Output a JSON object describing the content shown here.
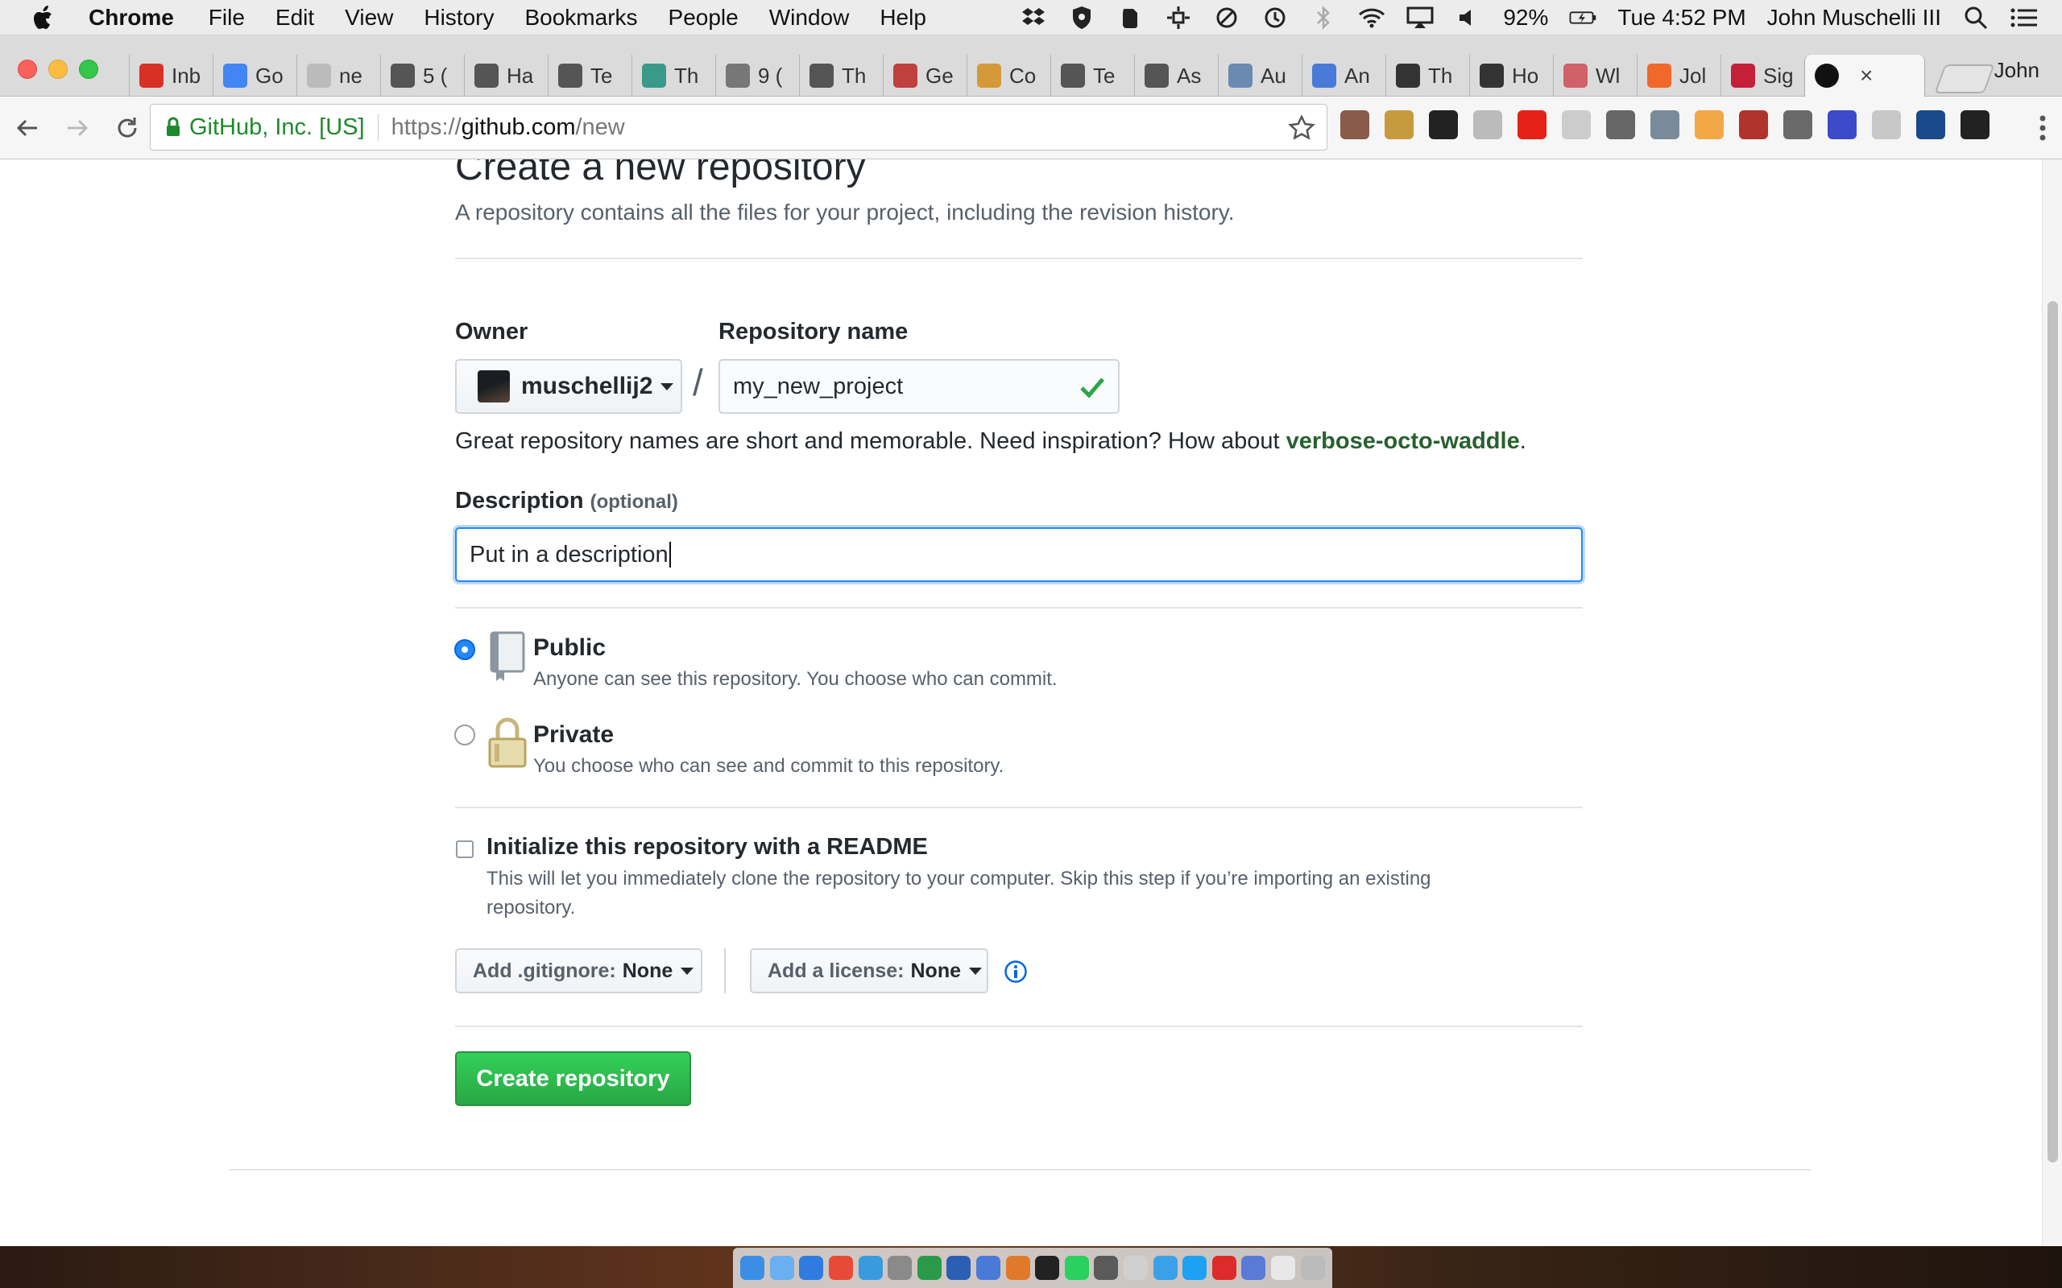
{
  "menubar": {
    "app": "Chrome",
    "menus": [
      "File",
      "Edit",
      "View",
      "History",
      "Bookmarks",
      "People",
      "Window",
      "Help"
    ],
    "battery": "92%",
    "clock": "Tue 4:52 PM",
    "user": "John Muschelli III",
    "status_icons": [
      "dropbox-icon",
      "shield-icon",
      "evernote-icon",
      "move-icon",
      "sync-icon",
      "time-machine-icon",
      "bluetooth-icon",
      "wifi-icon",
      "airplay-icon",
      "volume-icon",
      "battery-icon"
    ]
  },
  "tabs": [
    {
      "label": "Inb",
      "favicon": "gmail-icon",
      "color": "#d93025"
    },
    {
      "label": "Go",
      "favicon": "calendar-icon",
      "color": "#4285f4"
    },
    {
      "label": "ne",
      "favicon": "page-icon",
      "color": "#bbbbbb"
    },
    {
      "label": "5 (",
      "favicon": "nyt-icon",
      "color": "#555555"
    },
    {
      "label": "Ha",
      "favicon": "nyt-icon",
      "color": "#555555"
    },
    {
      "label": "Te",
      "favicon": "nyt-icon",
      "color": "#555555"
    },
    {
      "label": "Th",
      "favicon": "mic-icon",
      "color": "#3a9a8a"
    },
    {
      "label": "9 (",
      "favicon": "doc-icon",
      "color": "#777777"
    },
    {
      "label": "Th",
      "favicon": "d-icon",
      "color": "#555555"
    },
    {
      "label": "Ge",
      "favicon": "br-icon",
      "color": "#c04040"
    },
    {
      "label": "Co",
      "favicon": "e-icon",
      "color": "#d49a3a"
    },
    {
      "label": "Te",
      "favicon": "nyt-icon",
      "color": "#555555"
    },
    {
      "label": "As",
      "favicon": "nyt-icon",
      "color": "#555555"
    },
    {
      "label": "Au",
      "favicon": "audio-icon",
      "color": "#6a8ab0"
    },
    {
      "label": "An",
      "favicon": "docs-icon",
      "color": "#4a7ad8"
    },
    {
      "label": "Th",
      "favicon": "a-icon",
      "color": "#333333"
    },
    {
      "label": "Ho",
      "favicon": "i-icon",
      "color": "#333333"
    },
    {
      "label": "Wl",
      "favicon": "square-icon",
      "color": "#d0606a"
    },
    {
      "label": "Jol",
      "favicon": "etsy-icon",
      "color": "#f0682a"
    },
    {
      "label": "Sig",
      "favicon": "signin-icon",
      "color": "#c4203a"
    },
    {
      "label": "",
      "favicon": "github-icon",
      "color": "#111111",
      "active": true
    }
  ],
  "profile_name": "John",
  "omnibox": {
    "ev_label": "GitHub, Inc. [US]",
    "scheme": "https://",
    "host": "github.com",
    "path": "/new"
  },
  "extensions": [
    {
      "name": "ext-round-icon",
      "color": "#8a5a4a"
    },
    {
      "name": "ext-face-icon",
      "color": "#c89a40"
    },
    {
      "name": "evernote-ext-icon",
      "color": "#222222"
    },
    {
      "name": "dropbox-ext-icon",
      "color": "#bbbbbb"
    },
    {
      "name": "youtube-ext-icon",
      "color": "#e62117"
    },
    {
      "name": "search-ext-icon",
      "color": "#cccccc"
    },
    {
      "name": "cast-ext-icon",
      "color": "#666666"
    },
    {
      "name": "satellite-ext-icon",
      "color": "#7a8a9a"
    },
    {
      "name": "amazon-ext-icon",
      "color": "#f3a847"
    },
    {
      "name": "ublock-ext-icon",
      "color": "#b0342c"
    },
    {
      "name": "bubbles-ext-icon",
      "color": "#6a6a6a"
    },
    {
      "name": "c-ext-icon",
      "color": "#3a4ac8"
    },
    {
      "name": "blank-ext-icon",
      "color": "#c8c8c8"
    },
    {
      "name": "chart-ext-icon",
      "color": "#1a4a8a"
    },
    {
      "name": "amazon-smile-ext-icon",
      "color": "#222222"
    }
  ],
  "page": {
    "title": "Create a new repository",
    "subtitle": "A repository contains all the files for your project, including the revision history.",
    "owner_label": "Owner",
    "owner_value": "muschellij2",
    "slash": "/",
    "repo_label": "Repository name",
    "repo_value": "my_new_project",
    "hint_prefix": "Great repository names are short and memorable. Need inspiration? How about ",
    "hint_suggestion": "verbose-octo-waddle",
    "hint_suffix": ".",
    "description_label": "Description",
    "description_optional": "(optional)",
    "description_value": "Put in a description",
    "public_title": "Public",
    "public_desc": "Anyone can see this repository. You choose who can commit.",
    "private_title": "Private",
    "private_desc": "You choose who can see and commit to this repository.",
    "visibility_selected": "Public",
    "readme_title": "Initialize this repository with a README",
    "readme_desc_line1": "This will let you immediately clone the repository to your computer. Skip this step if you’re importing an existing",
    "readme_desc_line2": "repository.",
    "readme_checked": false,
    "gitignore_label": "Add .gitignore:",
    "gitignore_value": "None",
    "license_label": "Add a license:",
    "license_value": "None",
    "create_button": "Create repository"
  },
  "colors": {
    "accent_blue": "#2188ff",
    "create_green": "#28a745",
    "suggestion_green": "#28602e"
  },
  "dock": [
    "#3a8ee6",
    "#6ab0f0",
    "#2f7be0",
    "#e84a3a",
    "#3a9ae0",
    "#8a8a8a",
    "#2a9a4a",
    "#2b5fb4",
    "#4a7ad8",
    "#e07a2a",
    "#222222",
    "#2ad060",
    "#5a5a5a",
    "#d0d0d0",
    "#3aa0e8",
    "#1da1f2",
    "#dd2a2a",
    "#5a7ad8",
    "#e8e8e8",
    "#bbbbbb"
  ]
}
